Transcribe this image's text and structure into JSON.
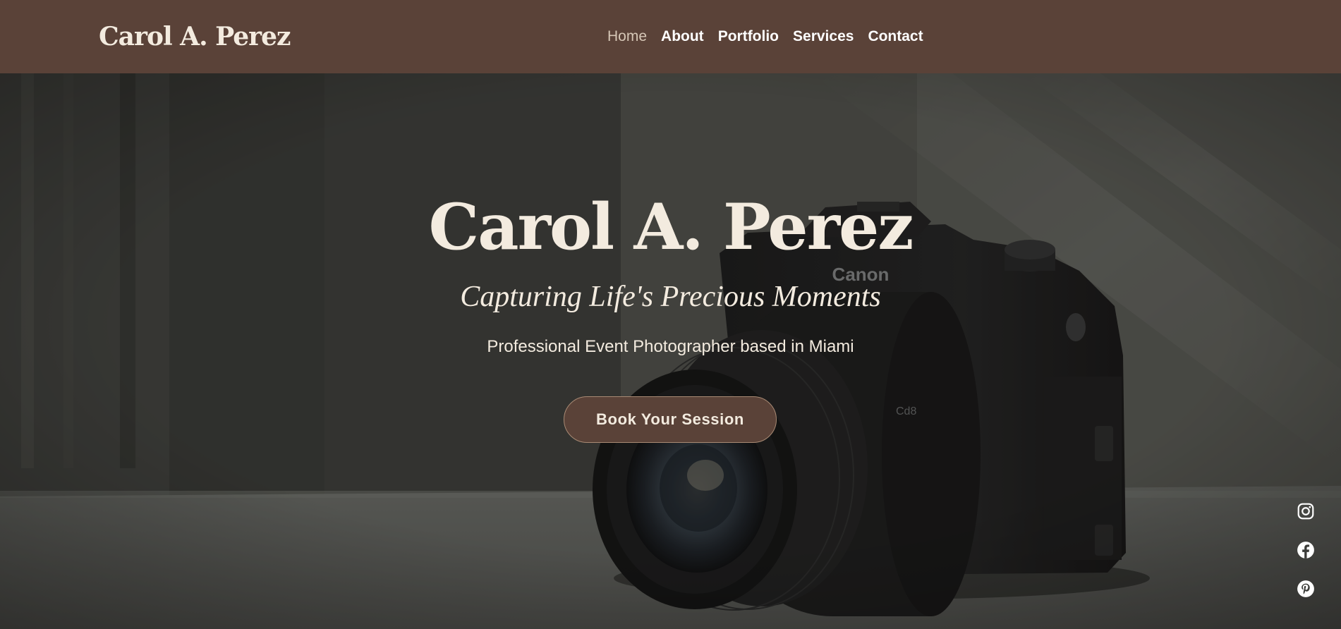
{
  "header": {
    "logo": "Carol A. Perez",
    "nav": [
      {
        "label": "Home",
        "active": true
      },
      {
        "label": "About",
        "active": false
      },
      {
        "label": "Portfolio",
        "active": false
      },
      {
        "label": "Services",
        "active": false
      },
      {
        "label": "Contact",
        "active": false
      }
    ]
  },
  "hero": {
    "title": "Carol A. Perez",
    "tagline": "Capturing Life's Precious Moments",
    "subtitle": "Professional Event Photographer based in Miami",
    "cta_label": "Book Your Session",
    "camera_brand": "Canon",
    "background_image": "dslr-camera-photo"
  },
  "social": [
    {
      "icon": "instagram-icon"
    },
    {
      "icon": "facebook-icon"
    },
    {
      "icon": "pinterest-icon"
    }
  ],
  "colors": {
    "header_bg": "#5a4238",
    "cream": "#f3ebdf",
    "nav_active": "#d6c7b6",
    "button_border": "#a88a74"
  }
}
